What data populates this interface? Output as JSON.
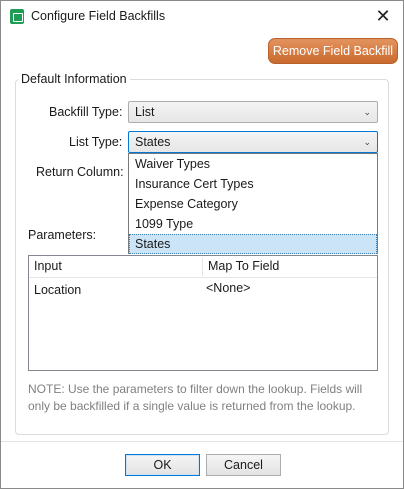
{
  "window": {
    "title": "Configure Field Backfills",
    "close_glyph": "✕"
  },
  "toolbar": {
    "remove_label": "Remove Field Backfill"
  },
  "group": {
    "title": "Default Information"
  },
  "fields": {
    "backfill_type": {
      "label": "Backfill Type:",
      "value": "List"
    },
    "list_type": {
      "label": "List Type:",
      "value": "States"
    },
    "return_column": {
      "label": "Return Column:"
    },
    "parameters": {
      "label": "Parameters:"
    }
  },
  "dropdown": {
    "items": [
      "Waiver Types",
      "Insurance Cert Types",
      "Expense Category",
      "1099 Type",
      "States"
    ],
    "selected_index": 4
  },
  "grid": {
    "columns": [
      "Input",
      "Map To Field"
    ],
    "rows": [
      {
        "input": "Location",
        "map_to": "<None>"
      }
    ]
  },
  "note": "NOTE: Use the parameters to filter down the lookup. Fields will only be backfilled if a single value is returned from the lookup.",
  "buttons": {
    "ok": "OK",
    "cancel": "Cancel"
  },
  "icons": {
    "chevron": "⌄",
    "app": "app-icon"
  },
  "colors": {
    "accent_orange": "#d9773a",
    "selection": "#cce4f7",
    "default_button_border": "#0078d7",
    "note_text": "#808080"
  }
}
